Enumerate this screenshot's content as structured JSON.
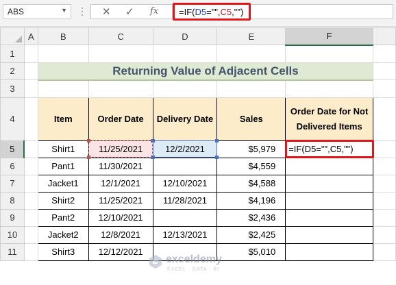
{
  "formula_bar": {
    "name_box": "ABS",
    "cancel_icon": "✕",
    "enter_icon": "✓",
    "fx_label": "fx",
    "formula_parts": [
      "=IF(",
      "D5",
      "=\"\",",
      "C5",
      ",\"\")"
    ]
  },
  "columns": [
    "A",
    "B",
    "C",
    "D",
    "E",
    "F"
  ],
  "rows": [
    "1",
    "2",
    "3",
    "4",
    "5",
    "6",
    "7",
    "8",
    "9",
    "10",
    "11"
  ],
  "title": "Returning Value of Adjacent Cells",
  "headers": [
    "Item",
    "Order Date",
    "Delivery Date",
    "Sales",
    "Order Date for Not Delivered Items"
  ],
  "data_rows": [
    {
      "item": "Shirt1",
      "order": "11/25/2021",
      "delivery": "12/2/2021",
      "sales": "$5,979",
      "result": "=IF(D5=\"\",C5,\"\")"
    },
    {
      "item": "Pant1",
      "order": "11/30/2021",
      "delivery": "",
      "sales": "$4,559",
      "result": ""
    },
    {
      "item": "Jacket1",
      "order": "12/1/2021",
      "delivery": "12/10/2021",
      "sales": "$4,588",
      "result": ""
    },
    {
      "item": "Shirt2",
      "order": "11/25/2021",
      "delivery": "11/28/2021",
      "sales": "$4,196",
      "result": ""
    },
    {
      "item": "Pant2",
      "order": "12/10/2021",
      "delivery": "",
      "sales": "$2,436",
      "result": ""
    },
    {
      "item": "Jacket2",
      "order": "12/8/2021",
      "delivery": "12/13/2021",
      "sales": "$2,425",
      "result": ""
    },
    {
      "item": "Shirt3",
      "order": "12/12/2021",
      "delivery": "",
      "sales": "$5,010",
      "result": ""
    }
  ],
  "watermark": {
    "name": "exceldemy",
    "tagline": "EXCEL · DATA · BI"
  },
  "colors": {
    "title_bg": "#dfe9d4",
    "header_bg": "#fdecca",
    "highlight_red": "#e0161a",
    "ref_blue": "#4472c4"
  }
}
